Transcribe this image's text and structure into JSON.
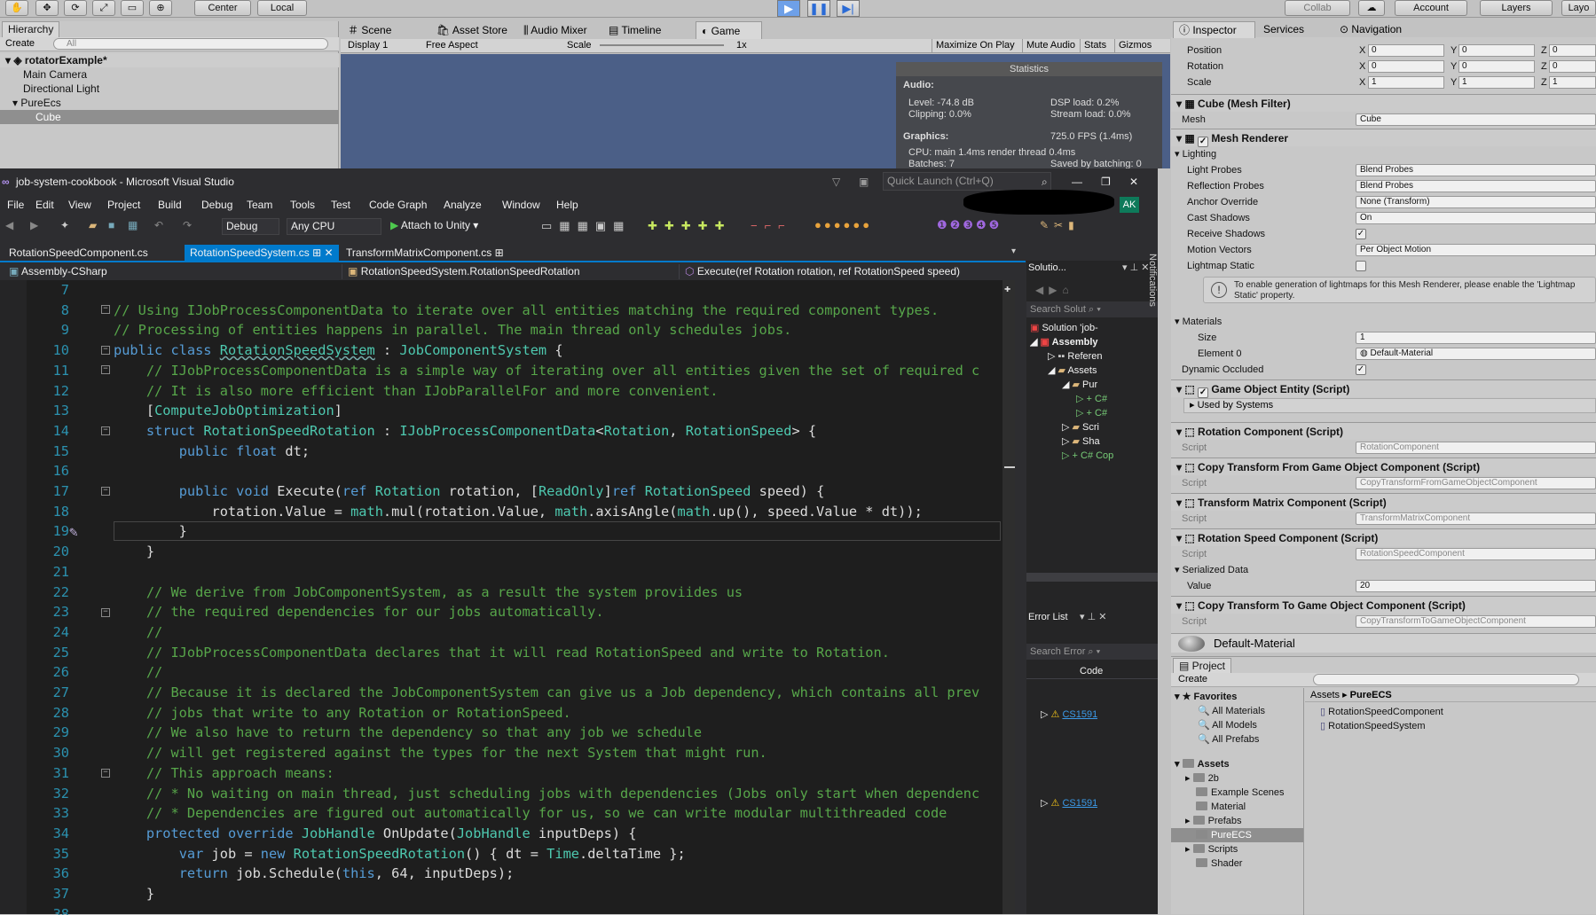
{
  "unity_toolbar": {
    "center_label": "Center",
    "local_label": "Local",
    "collab_label": "Collab",
    "account_label": "Account",
    "layers_label": "Layers",
    "layout_label": "Layo"
  },
  "hierarchy": {
    "tab": "Hierarchy",
    "create": "Create",
    "search_placeholder": "All",
    "scene": "rotatorExample*",
    "items": [
      "Main Camera",
      "Directional Light",
      "PureEcs",
      "Cube"
    ]
  },
  "game_view": {
    "tabs": [
      "Scene",
      "Asset Store",
      "Audio Mixer",
      "Timeline",
      "Game"
    ],
    "display": "Display 1",
    "aspect": "Free Aspect",
    "scale_label": "Scale",
    "scale_value": "1x",
    "buttons": [
      "Maximize On Play",
      "Mute Audio",
      "Stats",
      "Gizmos"
    ],
    "stats": {
      "title": "Statistics",
      "audio_label": "Audio:",
      "level": "Level: -74.8 dB",
      "clipping": "Clipping: 0.0%",
      "dsp": "DSP load: 0.2%",
      "stream": "Stream load: 0.0%",
      "graphics_label": "Graphics:",
      "fps": "725.0 FPS (1.4ms)",
      "cpu": "CPU: main 1.4ms  render thread 0.4ms",
      "batches": "Batches: 7",
      "saved": "Saved by batching: 0"
    }
  },
  "vs": {
    "title": "job-system-cookbook - Microsoft Visual Studio",
    "quick_launch": "Quick Launch (Ctrl+Q)",
    "user_initials": "AK",
    "menu": [
      "File",
      "Edit",
      "View",
      "Project",
      "Build",
      "Debug",
      "Team",
      "Tools",
      "Test",
      "Code Graph",
      "Analyze",
      "Window",
      "Help"
    ],
    "config": "Debug",
    "platform": "Any CPU",
    "attach": "Attach to Unity",
    "tabs": [
      "RotationSpeedComponent.cs",
      "RotationSpeedSystem.cs",
      "TransformMatrixComponent.cs"
    ],
    "nav": {
      "project": "Assembly-CSharp",
      "type": "RotationSpeedSystem.RotationSpeedRotation",
      "member": "Execute(ref Rotation rotation, ref RotationSpeed speed)"
    },
    "line_numbers": [
      "7",
      "8",
      "9",
      "10",
      "11",
      "12",
      "13",
      "14",
      "15",
      "16",
      "17",
      "18",
      "19",
      "20",
      "21",
      "22",
      "23",
      "24",
      "25",
      "26",
      "27",
      "28",
      "29",
      "30",
      "31",
      "32",
      "33",
      "34",
      "35",
      "36",
      "37",
      "38"
    ],
    "solution": {
      "title": "Solutio...",
      "search": "Search Solut",
      "items": [
        "Solution 'job-",
        "Assembly",
        "Referen",
        "Assets",
        "Pur",
        "C#",
        "C#",
        "Scri",
        "Sha",
        "C#  Cop"
      ]
    },
    "errors": {
      "title": "Error List",
      "search": "Search Error",
      "col_code": "Code",
      "codes": [
        "CS1591",
        "CS1591"
      ]
    },
    "notifications": "Notifications"
  },
  "inspector": {
    "tabs": [
      "Inspector",
      "Services",
      "Navigation"
    ],
    "transform": {
      "rows": [
        {
          "label": "Position",
          "x": "0",
          "y": "0",
          "z": "0"
        },
        {
          "label": "Rotation",
          "x": "0",
          "y": "0",
          "z": "0"
        },
        {
          "label": "Scale",
          "x": "1",
          "y": "1",
          "z": "1"
        }
      ]
    },
    "mesh_filter": {
      "title": "Cube (Mesh Filter)",
      "mesh_label": "Mesh",
      "mesh_value": "Cube"
    },
    "mesh_renderer": {
      "title": "Mesh Renderer",
      "lighting": "Lighting",
      "rows": [
        {
          "label": "Light Probes",
          "value": "Blend Probes"
        },
        {
          "label": "Reflection Probes",
          "value": "Blend Probes"
        },
        {
          "label": "Anchor Override",
          "value": "None (Transform)"
        },
        {
          "label": "Cast Shadows",
          "value": "On"
        },
        {
          "label": "Receive Shadows",
          "value": "✓"
        },
        {
          "label": "Motion Vectors",
          "value": "Per Object Motion"
        },
        {
          "label": "Lightmap Static",
          "value": ""
        }
      ],
      "info": "To enable generation of lightmaps for this Mesh Renderer, please enable the 'Lightmap Static' property.",
      "materials": "Materials",
      "size_label": "Size",
      "size_value": "1",
      "element_label": "Element 0",
      "element_value": "Default-Material",
      "dyn_label": "Dynamic Occluded"
    },
    "components": [
      {
        "title": "Game Object Entity (Script)",
        "sub": "Used by Systems"
      },
      {
        "title": "Rotation Component (Script)",
        "script": "RotationComponent"
      },
      {
        "title": "Copy Transform From Game Object Component (Script)",
        "script": "CopyTransformFromGameObjectComponent"
      },
      {
        "title": "Transform Matrix Component (Script)",
        "script": "TransformMatrixComponent"
      },
      {
        "title": "Rotation Speed Component (Script)",
        "script": "RotationSpeedComponent",
        "serialized": "Serialized Data",
        "value_label": "Value",
        "value": "20"
      },
      {
        "title": "Copy Transform To Game Object Component (Script)",
        "script": "CopyTransformToGameObjectComponent"
      }
    ],
    "script_label": "Script",
    "material": "Default-Material"
  },
  "project": {
    "tab": "Project",
    "create": "Create",
    "favorites": "Favorites",
    "fav_items": [
      "All Materials",
      "All Models",
      "All Prefabs"
    ],
    "assets": "Assets",
    "folders": [
      "2b",
      "Example Scenes",
      "Material",
      "Prefabs",
      "PureECS",
      "Scripts",
      "Shader"
    ],
    "breadcrumb": [
      "Assets",
      "PureECS"
    ],
    "files": [
      "RotationSpeedComponent",
      "RotationSpeedSystem"
    ]
  }
}
